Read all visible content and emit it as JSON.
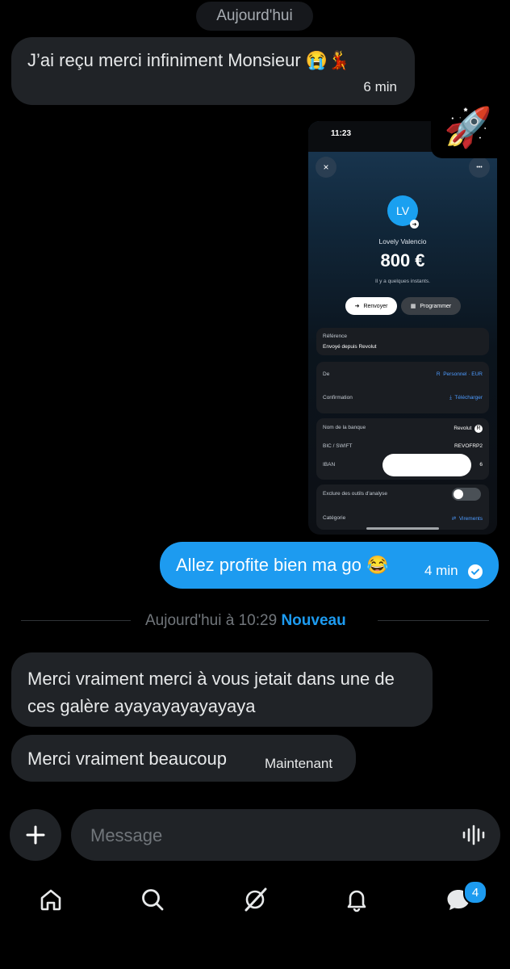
{
  "date_pill": "Aujourd'hui",
  "messages": {
    "incoming_1": {
      "text": "J’ai reçu merci infiniment Monsieur",
      "emoji": "😭💃",
      "time": "6 min"
    },
    "attachment_emoji": "🚀",
    "outgoing_1": {
      "text": "Allez profite bien ma go",
      "emoji": "😂",
      "time": "4 min"
    },
    "separator": {
      "label": "Aujourd'hui à 10:29",
      "highlight": "Nouveau"
    },
    "incoming_2": {
      "text": "Merci vraiment merci à vous jetait dans une de ces galère ayayayayayayaya"
    },
    "incoming_3": {
      "text": "Merci vraiment beaucoup",
      "time": "Maintenant"
    }
  },
  "screenshot": {
    "status_time": "11:23",
    "close_icon": "×",
    "more_icon": "•••",
    "avatar_initials": "LV",
    "name": "Lovely Valencio",
    "amount": "800 €",
    "ago": "Il y a quelques instants.",
    "actions": {
      "resend": "Renvoyer",
      "schedule": "Programmer"
    },
    "reference": {
      "label": "Référence",
      "value": "Envoyé depuis Revolut"
    },
    "from": {
      "label": "De",
      "value": "Personnel · EUR"
    },
    "confirmation": {
      "label": "Confirmation",
      "value": "Télécharger"
    },
    "bank": {
      "label": "Nom de la banque",
      "value": "Revolut"
    },
    "bic": {
      "label": "BIC / SWIFT",
      "value": "REVOFRP2"
    },
    "iban": {
      "label": "IBAN",
      "value": "6"
    },
    "exclude": {
      "label": "Exclure des outils d'analyse"
    },
    "category": {
      "label": "Catégorie",
      "value": "Virements"
    }
  },
  "composer": {
    "placeholder": "Message"
  },
  "nav": {
    "messages_badge": "4"
  },
  "colors": {
    "accent": "#1d9bf0",
    "bubble_in": "#202327",
    "background": "#000000"
  }
}
